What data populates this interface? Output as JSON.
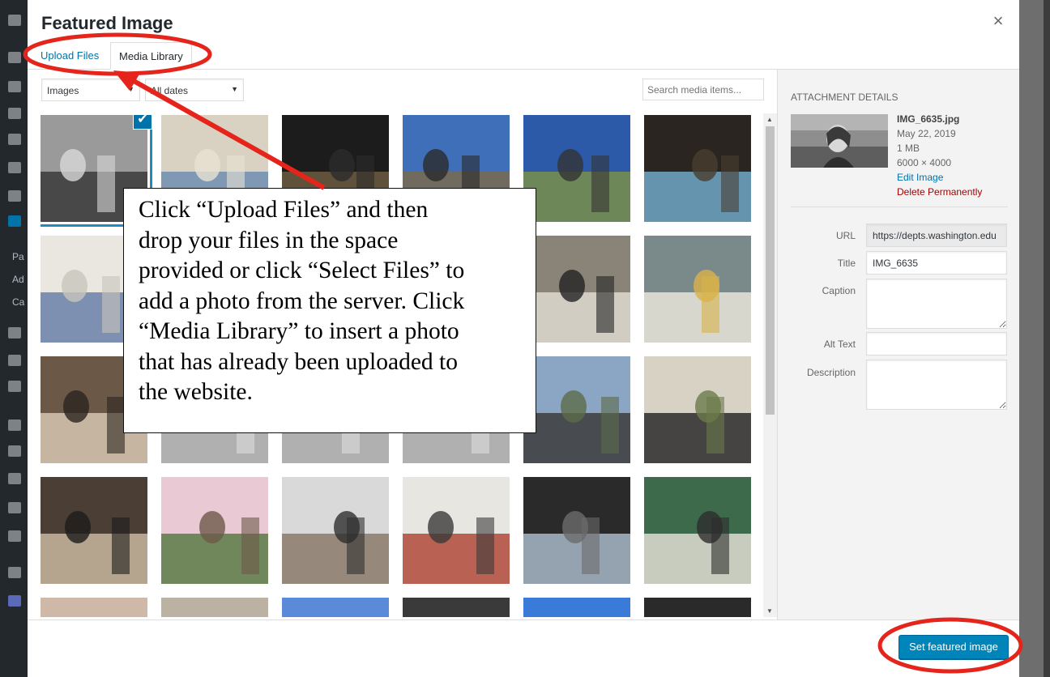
{
  "modal": {
    "title": "Featured Image",
    "close_icon": "close-icon"
  },
  "tabs": [
    {
      "label": "Upload Files"
    },
    {
      "label": "Media Library"
    }
  ],
  "filters": {
    "type_selected": "Images",
    "date_selected": "All dates",
    "search_placeholder": "Search media items..."
  },
  "attachment_details": {
    "heading": "ATTACHMENT DETAILS",
    "filename": "IMG_6635.jpg",
    "date": "May 22, 2019",
    "size": "1 MB",
    "dimensions": "6000 × 4000",
    "edit_link": "Edit Image",
    "delete_link": "Delete Permanently",
    "fields": {
      "url_label": "URL",
      "url_value": "https://depts.washington.edu",
      "title_label": "Title",
      "title_value": "IMG_6635",
      "caption_label": "Caption",
      "caption_value": "",
      "alt_label": "Alt Text",
      "alt_value": "",
      "description_label": "Description",
      "description_value": ""
    }
  },
  "footer": {
    "primary_button": "Set featured image"
  },
  "annotation": {
    "lines": [
      "Click “Upload Files” and then",
      "drop your files in the space",
      "provided or click “Select Files” to",
      "add a photo from the server. Click",
      "“Media Library” to insert a photo",
      "that has already been uploaded to",
      "the website."
    ],
    "highlight_color": "#e5251b"
  },
  "wp_sidebar_labels": [
    "Pa",
    "Ad",
    "Ca"
  ],
  "colors": {
    "accent": "#0073aa",
    "primary_button": "#0085ba",
    "delete": "#a00000"
  },
  "thumbnails": [
    {
      "name": "portrait-bw",
      "colors": [
        "#9a9a9a",
        "#3a3a3a",
        "#d8d8d8"
      ]
    },
    {
      "name": "poster-presenter",
      "colors": [
        "#d9d2c3",
        "#6f8fb3",
        "#e8e2d2"
      ]
    },
    {
      "name": "dark-stage",
      "colors": [
        "#1c1c1c",
        "#6b5a40",
        "#2c2c2c"
      ]
    },
    {
      "name": "campus-group",
      "colors": [
        "#3f6fb8",
        "#7a6a4d",
        "#2a2a2a"
      ]
    },
    {
      "name": "upside-down-group",
      "colors": [
        "#2c5aa8",
        "#7a8f4a",
        "#333"
      ]
    },
    {
      "name": "presentation-screen",
      "colors": [
        "#2a2520",
        "#6ea8c8",
        "#4a3d30"
      ]
    },
    {
      "name": "poster-wall",
      "colors": [
        "#e9e7e0",
        "#6a80a8",
        "#c8c5bd"
      ]
    },
    {
      "name": "hidden-1",
      "colors": [
        "#ccc",
        "#aaa",
        "#ddd"
      ]
    },
    {
      "name": "hidden-2",
      "colors": [
        "#ccc",
        "#aaa",
        "#ddd"
      ]
    },
    {
      "name": "hidden-3",
      "colors": [
        "#ccc",
        "#aaa",
        "#ddd"
      ]
    },
    {
      "name": "poster-student",
      "colors": [
        "#8a8478",
        "#ddd9d0",
        "#232323"
      ]
    },
    {
      "name": "poster-woman-yellow",
      "colors": [
        "#7a8a8a",
        "#e8e4d8",
        "#d9b24a"
      ]
    },
    {
      "name": "group-dinner",
      "colors": [
        "#6b5846",
        "#d6c7b1",
        "#2b2420"
      ]
    },
    {
      "name": "hidden-4",
      "colors": [
        "#ccc",
        "#aaa",
        "#ddd"
      ]
    },
    {
      "name": "hidden-5",
      "colors": [
        "#ccc",
        "#aaa",
        "#ddd"
      ]
    },
    {
      "name": "hidden-6",
      "colors": [
        "#ccc",
        "#aaa",
        "#ddd"
      ]
    },
    {
      "name": "award-group",
      "colors": [
        "#8aa6c4",
        "#3c3c3c",
        "#5d6b4a"
      ]
    },
    {
      "name": "group-hall",
      "colors": [
        "#d8d2c5",
        "#2b2b2b",
        "#6a7a4a"
      ]
    },
    {
      "name": "dinner-table",
      "colors": [
        "#4a3e35",
        "#c9b79e",
        "#1c1c1c"
      ]
    },
    {
      "name": "cherry-blossom-1",
      "colors": [
        "#e8c9d4",
        "#5a7a45",
        "#6d5a4a"
      ]
    },
    {
      "name": "cherry-blossom-2",
      "colors": [
        "#d9d9d9",
        "#8a7a6a",
        "#2e2e2e"
      ]
    },
    {
      "name": "debunking-stereotypes",
      "colors": [
        "#e8e6e1",
        "#b04a3a",
        "#3a3a3a"
      ]
    },
    {
      "name": "spsp-podium",
      "colors": [
        "#2a2a2a",
        "#a8b8c8",
        "#6b6b6b"
      ]
    },
    {
      "name": "poster-pair",
      "colors": [
        "#3c6a4a",
        "#e1ddd3",
        "#2d2d2d"
      ]
    },
    {
      "name": "row5-1",
      "colors": [
        "#d0b8a8",
        "#8a6a5a",
        "#fff"
      ]
    },
    {
      "name": "row5-2",
      "colors": [
        "#bcb2a4",
        "#6a5a4a",
        "#fff"
      ]
    },
    {
      "name": "row5-3",
      "colors": [
        "#5a8ad8",
        "#8ab0e8",
        "#fff"
      ]
    },
    {
      "name": "row5-4",
      "colors": [
        "#3a3a3a",
        "#9a8a7a",
        "#fff"
      ]
    },
    {
      "name": "row5-5",
      "colors": [
        "#3a7ad8",
        "#7ab0f0",
        "#fff"
      ]
    },
    {
      "name": "row5-6",
      "colors": [
        "#2a2a2a",
        "#8a4a7a",
        "#fff"
      ]
    }
  ]
}
